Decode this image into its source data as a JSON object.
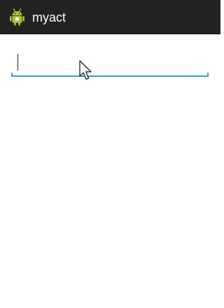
{
  "app": {
    "title": "myact",
    "icon": "android-robot-icon"
  },
  "edit_field": {
    "value": "",
    "focused": true,
    "accent_color": "#33a4cc"
  },
  "action_bar": {
    "background_color": "#222222"
  }
}
